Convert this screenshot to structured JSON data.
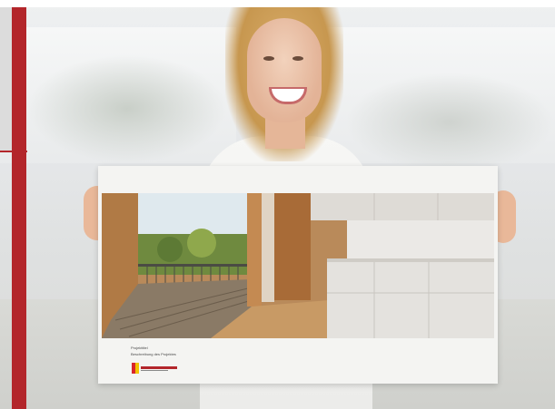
{
  "scene": {
    "description_colors": {
      "accent_red": "#b3262b",
      "wood": "#b98a5a",
      "cabinet": "#e4e2de"
    }
  },
  "board": {
    "caption_line_1": "Projekttitel",
    "caption_line_2": "Beschreibung des Projektes"
  }
}
